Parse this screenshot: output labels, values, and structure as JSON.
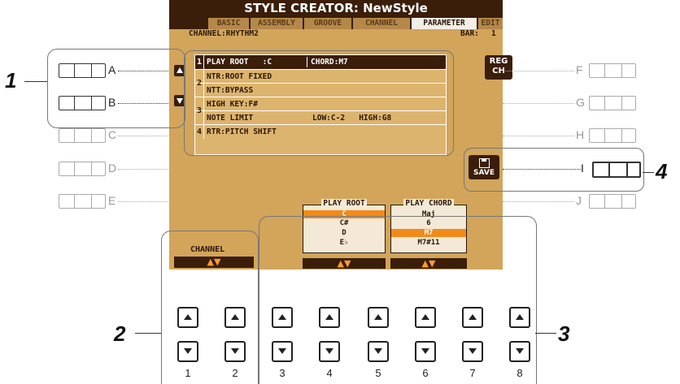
{
  "lcd": {
    "title": "STYLE CREATOR: NewStyle",
    "tabs": [
      "BASIC",
      "ASSEMBLY",
      "GROOVE",
      "CHANNEL",
      "PARAMETER",
      "EDIT"
    ],
    "active_tab": "PARAMETER",
    "channel_label": "CHANNEL:RHYTHM2",
    "bar_label": "BAR:",
    "bar_value": "1",
    "rows": [
      {
        "num": "1",
        "text": "PLAY ROOT   :C",
        "extra": "CHORD:M7",
        "highlight": true
      },
      {
        "num": "2",
        "text": "NTR:ROOT FIXED"
      },
      {
        "num": "",
        "text": "NTT:BYPASS"
      },
      {
        "num": "3",
        "text": "HIGH KEY:F#"
      },
      {
        "num": "",
        "text": "NOTE LIMIT",
        "extra": "LOW:C-2   HIGH:G8"
      },
      {
        "num": "4",
        "text": "RTR:PITCH SHIFT"
      }
    ],
    "reg_ch": [
      "REG",
      "CH"
    ],
    "save": "SAVE",
    "channel_button": "CHANNEL",
    "arrows": "▲▼",
    "play_root": {
      "title": "PLAY ROOT",
      "items": [
        "C",
        "C#",
        "D",
        "E♭"
      ],
      "selected": "C"
    },
    "play_chord": {
      "title": "PLAY CHORD",
      "items": [
        "Maj",
        "6",
        "M7",
        "M7#11"
      ],
      "selected": "M7"
    }
  },
  "left_labels": [
    "A",
    "B",
    "C",
    "D",
    "E"
  ],
  "right_labels": [
    "F",
    "G",
    "H",
    "I",
    "J"
  ],
  "callouts": [
    "1",
    "2",
    "3",
    "4"
  ],
  "knob_numbers": [
    "1",
    "2",
    "3",
    "4",
    "5",
    "6",
    "7",
    "8"
  ]
}
